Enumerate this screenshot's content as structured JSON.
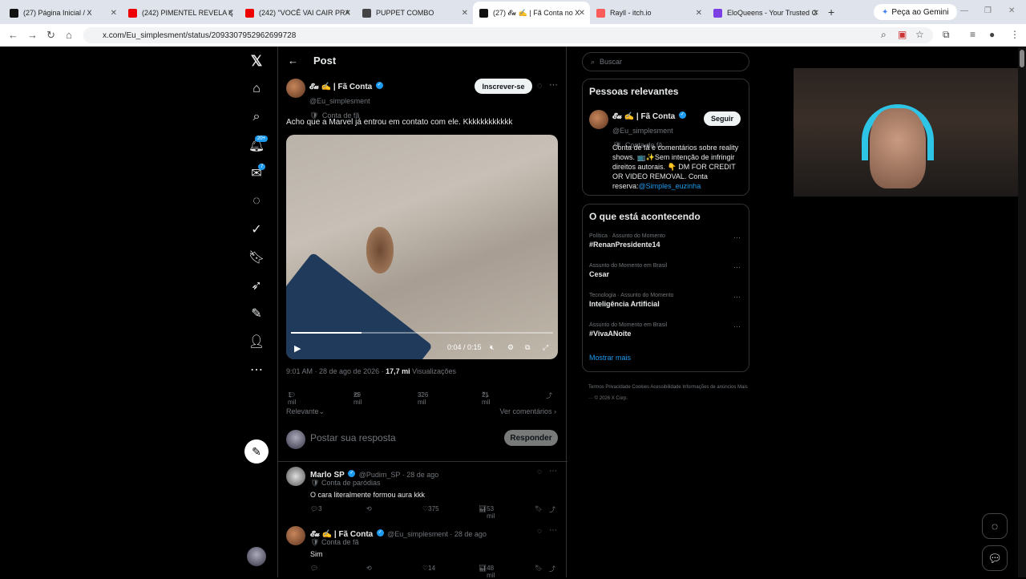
{
  "tabs": [
    {
      "title": "(27) Página Inicial / X",
      "fav": "#111"
    },
    {
      "title": "(242) PIMENTEL REVELA QU",
      "fav": "#e00"
    },
    {
      "title": "(242) \"VOCÊ VAI CAIR PRA",
      "fav": "#e00"
    },
    {
      "title": "PUPPET COMBO",
      "fav": "#444"
    },
    {
      "title": "(27) 𝓔𝓾 ✍️ | Fã Conta no X",
      "fav": "#111"
    },
    {
      "title": "Rayll - itch.io",
      "fav": "#fa5c5c"
    },
    {
      "title": "EloQueens - Your Trusted G",
      "fav": "#7b3fe4"
    }
  ],
  "gemini_label": "Peça ao Gemini",
  "url": "x.com/Eu_simplesment/status/2093307952962699728",
  "nav": {
    "badge_notifications": "20+",
    "badge_messages": "7"
  },
  "post": {
    "header_title": "Post",
    "author_name": "𝓔𝓾 ✍️ | Fã Conta",
    "author_handle": "@Eu_simplesment",
    "author_label": "Conta de fã",
    "subscribe": "Inscrever-se",
    "text": "Acho que a Marvel  já entrou em contato com ele. Kkkkkkkkkkkk",
    "video_time": "0:04 / 0:15",
    "video_progress": 0.27,
    "timestamp": "9:01 AM · 28 de ago de 2026 ·",
    "views_count": "17,7 mi",
    "views_label": "Visualizações",
    "replies": "1 mil",
    "reposts": "29 mil",
    "likes": "326 mil",
    "bookmarks": "21 mil",
    "relevance": "Relevante",
    "view_quotes": "Ver comentários"
  },
  "reply_box": {
    "placeholder": "Postar sua resposta",
    "button": "Responder"
  },
  "comments": [
    {
      "name": "Marlo SP",
      "handle": "@Pudim_SP · 28 de ago",
      "label": "Conta de paródias",
      "text": "O cara literalmente formou aura kkk",
      "replies": "3",
      "likes": "375",
      "views": "53 mil"
    },
    {
      "name": "𝓔𝓾 ✍️ | Fã Conta",
      "handle": "@Eu_simplesment · 28 de ago",
      "label": "Conta de fã",
      "text": "Sim",
      "replies": "",
      "likes": "14",
      "views": "48 mil"
    }
  ],
  "sidebar": {
    "search_placeholder": "Buscar",
    "relevant_title": "Pessoas relevantes",
    "person_name": "𝓔𝓾 ✍️ | Fã Conta",
    "person_handle": "@Eu_simplesment",
    "person_label": "Conta de fã",
    "follow": "Seguir",
    "bio": "Conta de fã e comentários sobre reality shows. 📺✨Sem intenção de infringir direitos autorais. 👇 DM FOR CREDIT OR VIDEO REMOVAL. Conta reserva:",
    "bio_link": "@Simples_euzinha",
    "trending_title": "O que está acontecendo",
    "trends": [
      {
        "context": "Política · Assunto do Momento",
        "tag": "#RenanPresidente14"
      },
      {
        "context": "Assunto do Momento em Brasil",
        "tag": "Cesar"
      },
      {
        "context": "Tecnologia · Assunto do Momento",
        "tag": "Inteligência Artificial"
      },
      {
        "context": "Assunto do Momento em Brasil",
        "tag": "#VivaANoite"
      }
    ],
    "show_more": "Mostrar mais",
    "footer": "Termos    Privacidade    Cookies    Acessibilidade    Informações de anúncios    Mais ···    © 2026 X Corp."
  }
}
